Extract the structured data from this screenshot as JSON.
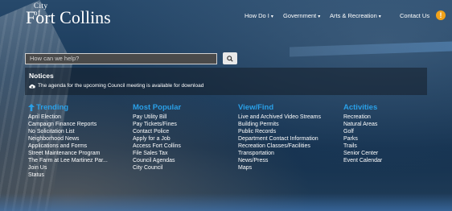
{
  "header": {
    "logo_cityof": "City of",
    "logo_name": "Fort Collins",
    "nav": [
      {
        "label": "How Do I",
        "caret": "▾"
      },
      {
        "label": "Government",
        "caret": "▾"
      },
      {
        "label": "Arts & Recreation",
        "caret": "▾"
      },
      {
        "label": "Contact Us",
        "caret": ""
      }
    ],
    "alert_icon": "!"
  },
  "search": {
    "placeholder": "How can we help?",
    "icon": "search-icon"
  },
  "notices": {
    "title": "Notices",
    "item": "The agenda for the upcoming Council meeting is available for download",
    "icon": "cloud-download-icon"
  },
  "columns": {
    "trending": {
      "title": "Trending",
      "icon": "arrow-up-icon",
      "items": [
        "April Election",
        "Campaign Finance Reports",
        "No Solicitation List",
        "Neighborhood News",
        "Applications and Forms",
        "Street Maintenance Program",
        "The Farm at Lee Martinez Par...",
        "Join Us",
        "Status"
      ]
    },
    "popular": {
      "title": "Most Popular",
      "items": [
        "Pay Utility Bill",
        "Pay Tickets/Fines",
        "Contact Police",
        "Apply for a Job",
        "Access Fort Collins",
        "File Sales Tax",
        "Council Agendas",
        "City Council"
      ]
    },
    "viewfind": {
      "title": "View/Find",
      "items": [
        "Live and Archived Video Streams",
        "Building Permits",
        "Public Records",
        "Department Contact Information",
        "Recreation Classes/Facilities",
        "Transportation",
        "News/Press",
        "Maps"
      ]
    },
    "activities": {
      "title": "Activities",
      "items": [
        "Recreation",
        "Natural Areas",
        "Golf",
        "Parks",
        "Trails",
        "Senior Center",
        "Event Calendar"
      ]
    }
  },
  "colors": {
    "accent_blue": "#2aa0e8",
    "alert_orange": "#f0a21a"
  }
}
